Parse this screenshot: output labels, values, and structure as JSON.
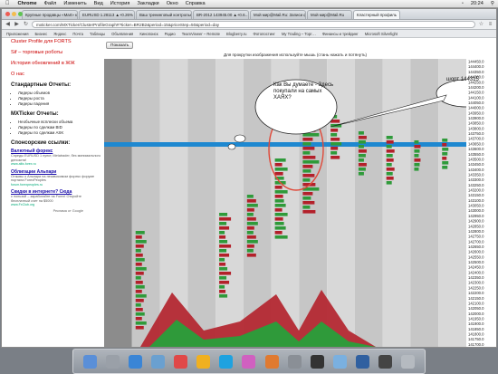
{
  "menubar": {
    "apple": "",
    "app": "Chrome",
    "items": [
      "Файл",
      "Изменить",
      "Вид",
      "История",
      "Закладки",
      "Окно",
      "Справка"
    ],
    "clock": "20:24"
  },
  "tabs": [
    {
      "label": "Крупные продавцы «Mart» купе…"
    },
    {
      "label": "EURUSD  1.28113 ▲+0.26%"
    },
    {
      "label": "Ваш тренинговый контрольн…"
    },
    {
      "label": "BR-2012  143945.00 ▲+0.6…"
    },
    {
      "label": "Мой мир@Mail.Ru: Записи ф…"
    },
    {
      "label": "Мой мир@Mail.Ru"
    },
    {
      "label": "Кластерный профиль"
    }
  ],
  "address": {
    "url": "mxticker.com/MXTicker/ClusterProfileGraph#?ticker=BR2B2&period=15&priceStep=50&period=day"
  },
  "bookmarks": [
    "Приложения",
    "Бизнес",
    "Яндекс",
    "Почта",
    "Таблицы",
    "Объявления",
    "Кинопоиск",
    "Радио",
    "TeamViewer – Remote",
    "Blogberry.ru",
    "Фотопостинг",
    "My Trading – Торг…",
    "Финансы и трейдинг",
    "Microsoft Silverlight"
  ],
  "sidebar": {
    "links": [
      "Cluster Profile для FORTS",
      "Sif – торговые роботы",
      "История обновлений в ЖЖ",
      "О нас"
    ],
    "std_heading": "Стандартные Отчеты:",
    "std_items": [
      "Лидеры объемов",
      "Лидеры роста",
      "Лидеры падения"
    ],
    "mx_heading": "MXTicker Отчеты:",
    "mx_items": [
      "Необычные всплески объема",
      "Лидеры по сделкам BID",
      "Лидеры по сделкам ASK"
    ],
    "sponsor_heading": "Спонсорские ссылки:",
    "ads": [
      {
        "title": "Валютный форекс",
        "text": "Спреды EURUSD 1 пункт, Metatrader, без минимального депозита!",
        "url": "www.alfa-forex.ru"
      },
      {
        "title": "Облигации Альпари",
        "text": "Отзывы о Альпари на независимом форекс форуме портала ForexPeoples",
        "url": "forum.forexpeoples.ru"
      },
      {
        "title": "Скидки в интернете? Сюда",
        "text": "с пользой – заработайте на Forex! Откройте бесплатный счет на $5000",
        "url": "www.FxClub.org"
      }
    ],
    "ads_by": "Реклама от Google"
  },
  "show_button": "Показать",
  "hint": "Для прокрутки изображения используйте мышь (стань нажать и потянуть)",
  "annotations": {
    "cloud1": "Как Вы думаете - Здесь покупали на самых ХАЯХ?",
    "cloud2": "шорт 144315"
  },
  "colors": {
    "bid": "#b3202a",
    "ask": "#2f9a3a",
    "level_highlight": "#1e88d0",
    "circle": "#e04a3a"
  },
  "price_axis": {
    "labels": [
      "144450.0",
      "144400.0",
      "144350.0",
      "144300.0",
      "144250.0",
      "144200.0",
      "144150.0",
      "144100.0",
      "144050.0",
      "144000.0",
      "143950.0",
      "143900.0",
      "143850.0",
      "143800.0",
      "143750.0",
      "143700.0",
      "143650.0",
      "143600.0",
      "143550.0",
      "143500.0",
      "143450.0",
      "143400.0",
      "143350.0",
      "143300.0",
      "143250.0",
      "143200.0",
      "143150.0",
      "143100.0",
      "143050.0",
      "143000.0",
      "142950.0",
      "142900.0",
      "142850.0",
      "142800.0",
      "142750.0",
      "142700.0",
      "142650.0",
      "142600.0",
      "142550.0",
      "142500.0",
      "142450.0",
      "142400.0",
      "142350.0",
      "142300.0",
      "142250.0",
      "142200.0",
      "142150.0",
      "142100.0",
      "142050.0",
      "142000.0",
      "141950.0",
      "141900.0",
      "141850.0",
      "141800.0",
      "141750.0",
      "141700.0"
    ]
  },
  "dock": {
    "icons": [
      "finder-icon",
      "launchpad-icon",
      "safari-icon",
      "mail-icon",
      "calendar-icon",
      "chrome-icon",
      "skype-icon",
      "itunes-icon",
      "photos-icon",
      "settings-icon",
      "terminal-icon",
      "preview-icon",
      "quicktime-icon",
      "dashboard-icon",
      "trash-icon"
    ]
  }
}
